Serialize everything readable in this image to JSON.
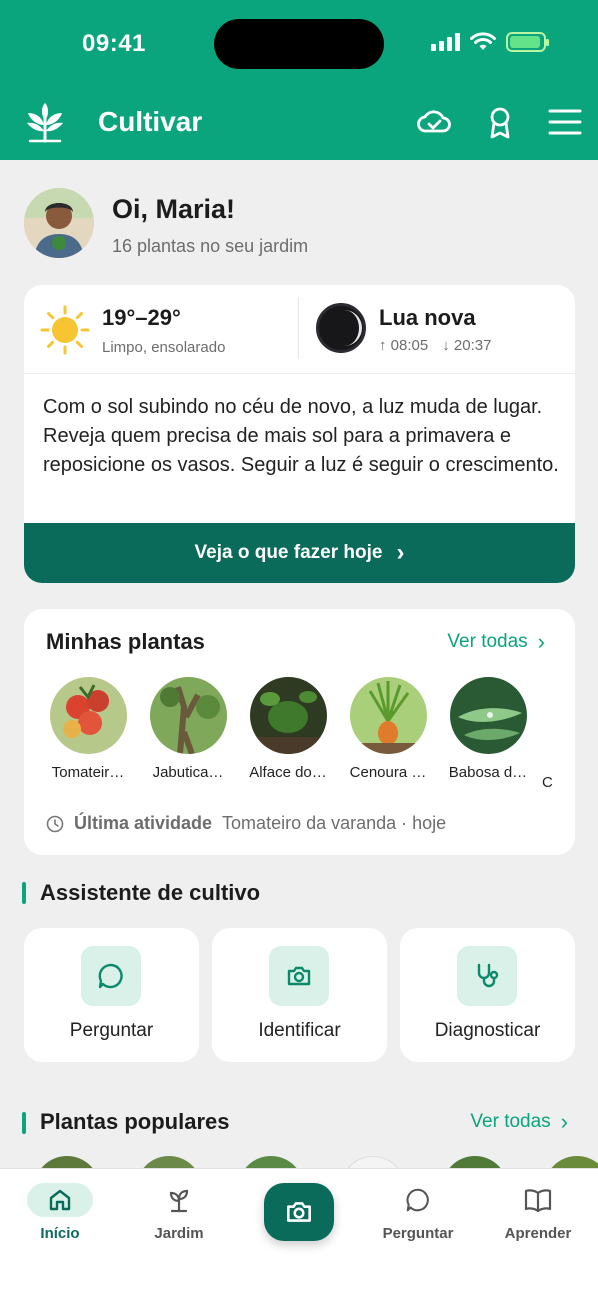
{
  "status_bar": {
    "time": "09:41"
  },
  "header": {
    "app_name": "Cultivar"
  },
  "greeting": {
    "title": "Oi, Maria!",
    "subtitle": "16 plantas no seu jardim"
  },
  "weather": {
    "temp": "19°–29°",
    "desc": "Limpo, ensolarado",
    "moon_title": "Lua nova",
    "moonrise": "↑ 08:05",
    "moonset": "↓ 20:37",
    "tip": "Com o sol subindo no céu de novo, a luz muda de lugar. Reveja quem precisa de mais sol para a primavera e reposicione os vasos. Seguir a luz é seguir o crescimento.",
    "cta": "Veja o que fazer hoje",
    "cta_arrow": "›"
  },
  "my_plants": {
    "title": "Minhas plantas",
    "see_all": "Ver todas",
    "see_all_arrow": "›",
    "items": [
      {
        "name": "Tomateir…",
        "color": "#c9412e"
      },
      {
        "name": "Jabutica…",
        "color": "#6a5a3c"
      },
      {
        "name": "Alface do…",
        "color": "#3f7a2c"
      },
      {
        "name": "Cenoura …",
        "color": "#e17b2c"
      },
      {
        "name": "Babosa d…",
        "color": "#4e9a5a"
      }
    ],
    "activity_label": "Última atividade",
    "activity_value": "Tomateiro da varanda · hoje"
  },
  "assistant": {
    "title": "Assistente de cultivo",
    "tools": [
      {
        "label": "Perguntar",
        "icon": "chat-icon"
      },
      {
        "label": "Identificar",
        "icon": "camera-icon"
      },
      {
        "label": "Diagnosticar",
        "icon": "stethoscope-icon"
      }
    ]
  },
  "popular": {
    "title": "Plantas populares",
    "see_all": "Ver todas",
    "see_all_arrow": "›"
  },
  "bottom_nav": {
    "items": [
      {
        "label": "Início",
        "icon": "home-icon",
        "active": true
      },
      {
        "label": "Jardim",
        "icon": "sprout-icon"
      },
      {
        "label": "Perguntar",
        "icon": "chat-icon"
      },
      {
        "label": "Aprender",
        "icon": "book-icon"
      }
    ],
    "camera_icon": "camera-icon"
  },
  "colors": {
    "brand": "#0aa57c",
    "brand_dark": "#0a6b5a",
    "accent_bg": "#d9f1e8"
  }
}
